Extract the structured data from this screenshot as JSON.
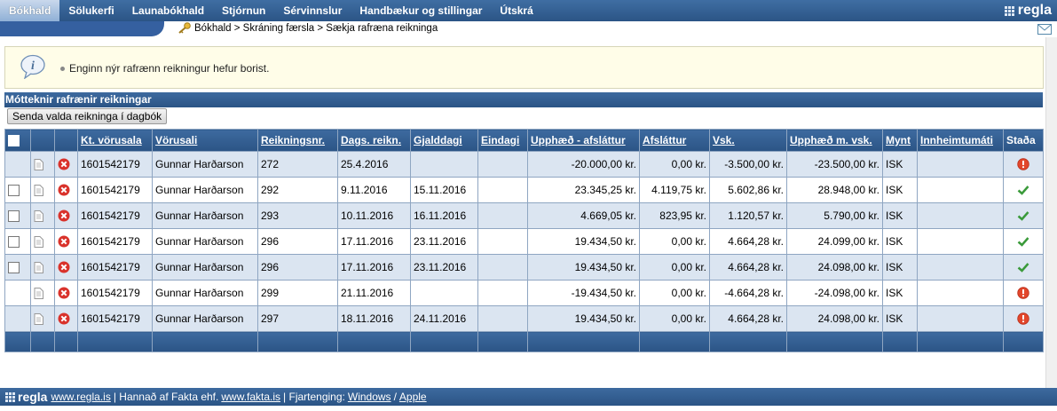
{
  "nav": {
    "items": [
      "Bókhald",
      "Sölukerfi",
      "Launabókhald",
      "Stjórnun",
      "Sérvinnslur",
      "Handbækur og stillingar",
      "Útskrá"
    ],
    "active": 0,
    "logo": "regla"
  },
  "breadcrumb": "Bókhald > Skráning færsla > Sækja rafræna reikninga",
  "info": {
    "message": "Enginn nýr rafrænn reikningur hefur borist."
  },
  "section_title": "Mótteknir rafrænir reikningar",
  "send_button": "Senda valda reikninga í dagbók",
  "table": {
    "headers": [
      "Kt. vörusala",
      "Vörusali",
      "Reikningsnr.",
      "Dags. reikn.",
      "Gjalddagi",
      "Eindagi",
      "Upphæð - afsláttur",
      "Afsláttur",
      "Vsk.",
      "Upphæð m. vsk.",
      "Mynt",
      "Innheimtumáti",
      "Staða"
    ],
    "rows": [
      {
        "checkbox": false,
        "kt": "1601542179",
        "seller": "Gunnar Harðarson",
        "nr": "272",
        "date": "25.4.2016",
        "due": "",
        "final": "",
        "amount": "-20.000,00 kr.",
        "discount": "0,00 kr.",
        "vat": "-3.500,00 kr.",
        "total": "-23.500,00 kr.",
        "currency": "ISK",
        "method": "",
        "status": "error"
      },
      {
        "checkbox": true,
        "kt": "1601542179",
        "seller": "Gunnar Harðarson",
        "nr": "292",
        "date": "9.11.2016",
        "due": "15.11.2016",
        "final": "",
        "amount": "23.345,25 kr.",
        "discount": "4.119,75 kr.",
        "vat": "5.602,86 kr.",
        "total": "28.948,00 kr.",
        "currency": "ISK",
        "method": "",
        "status": "ok"
      },
      {
        "checkbox": true,
        "kt": "1601542179",
        "seller": "Gunnar Harðarson",
        "nr": "293",
        "date": "10.11.2016",
        "due": "16.11.2016",
        "final": "",
        "amount": "4.669,05 kr.",
        "discount": "823,95 kr.",
        "vat": "1.120,57 kr.",
        "total": "5.790,00 kr.",
        "currency": "ISK",
        "method": "",
        "status": "ok"
      },
      {
        "checkbox": true,
        "kt": "1601542179",
        "seller": "Gunnar Harðarson",
        "nr": "296",
        "date": "17.11.2016",
        "due": "23.11.2016",
        "final": "",
        "amount": "19.434,50 kr.",
        "discount": "0,00 kr.",
        "vat": "4.664,28 kr.",
        "total": "24.099,00 kr.",
        "currency": "ISK",
        "method": "",
        "status": "ok"
      },
      {
        "checkbox": true,
        "kt": "1601542179",
        "seller": "Gunnar Harðarson",
        "nr": "296",
        "date": "17.11.2016",
        "due": "23.11.2016",
        "final": "",
        "amount": "19.434,50 kr.",
        "discount": "0,00 kr.",
        "vat": "4.664,28 kr.",
        "total": "24.098,00 kr.",
        "currency": "ISK",
        "method": "",
        "status": "ok"
      },
      {
        "checkbox": false,
        "kt": "1601542179",
        "seller": "Gunnar Harðarson",
        "nr": "299",
        "date": "21.11.2016",
        "due": "",
        "final": "",
        "amount": "-19.434,50 kr.",
        "discount": "0,00 kr.",
        "vat": "-4.664,28 kr.",
        "total": "-24.098,00 kr.",
        "currency": "ISK",
        "method": "",
        "status": "error"
      },
      {
        "checkbox": false,
        "kt": "1601542179",
        "seller": "Gunnar Harðarson",
        "nr": "297",
        "date": "18.11.2016",
        "due": "24.11.2016",
        "final": "",
        "amount": "19.434,50 kr.",
        "discount": "0,00 kr.",
        "vat": "4.664,28 kr.",
        "total": "24.098,00 kr.",
        "currency": "ISK",
        "method": "",
        "status": "error"
      }
    ]
  },
  "footer": {
    "logo": "regla",
    "site_link": "www.regla.is",
    "made_by": "| Hannað af Fakta ehf.",
    "fakta_link": "www.fakta.is",
    "remote_label": "| Fjartenging:",
    "windows_link": "Windows",
    "separator": "/",
    "apple_link": "Apple"
  }
}
